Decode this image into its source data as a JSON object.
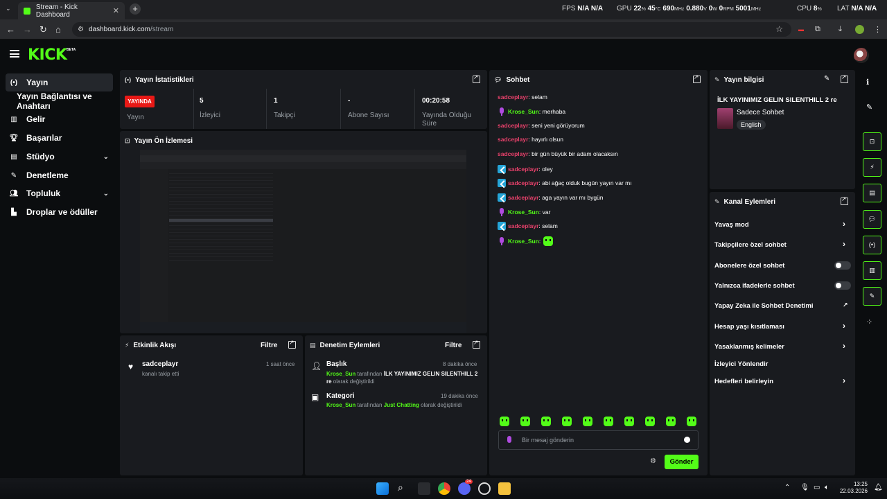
{
  "browser": {
    "tab_title": "Stream - Kick Dashboard",
    "url_domain": "dashboard.kick.com",
    "url_path": "/stream"
  },
  "overlay": {
    "fps_label": "FPS",
    "fps_value": "N/A",
    "fps_value2": "N/A",
    "gpu_label": "GPU",
    "gpu_load": "22",
    "gpu_temp": "45",
    "gpu_clock": "690",
    "gpu_volt": "0.880",
    "gpu_power": "0",
    "gpu_fan": "0",
    "gpu_mem": "5001",
    "cpu_label": "CPU",
    "cpu_load": "8",
    "lat_label": "LAT",
    "lat_value": "N/A",
    "lat_value2": "N/A"
  },
  "sidebar": {
    "items": [
      {
        "label": "Yayın",
        "icon": "broadcast-icon"
      },
      {
        "label": "Yayın Bağlantısı ve Anahtarı"
      },
      {
        "label": "Gelir",
        "icon": "revenue-icon"
      },
      {
        "label": "Başarılar",
        "icon": "trophy-icon"
      },
      {
        "label": "Stüdyo",
        "icon": "studio-icon"
      },
      {
        "label": "Denetleme",
        "icon": "wrench-icon"
      },
      {
        "label": "Topluluk",
        "icon": "community-icon"
      },
      {
        "label": "Droplar ve ödüller",
        "icon": "drops-icon"
      }
    ]
  },
  "stats": {
    "title": "Yayın İstatistikleri",
    "live_badge": "YAYINDA",
    "items": [
      {
        "value": "",
        "label": "Yayın"
      },
      {
        "value": "5",
        "label": "İzleyici"
      },
      {
        "value": "1",
        "label": "Takipçi"
      },
      {
        "value": "-",
        "label": "Abone Sayısı"
      },
      {
        "value": "00:20:58",
        "label": "Yayında Olduğu Süre"
      }
    ]
  },
  "preview": {
    "title": "Yayın Ön İzlemesi"
  },
  "activity": {
    "title": "Etkinlik Akışı",
    "filter": "Filtre",
    "events": [
      {
        "user": "sadceplayr",
        "text": "kanalı takip etti",
        "time": "1 saat önce"
      }
    ]
  },
  "mod_actions": {
    "title": "Denetim Eylemleri",
    "filter": "Filtre",
    "items": [
      {
        "heading": "Başlık",
        "time": "8 dakika önce",
        "user": "Krose_Sun",
        "by": "tarafından",
        "value": "İLK YAYINIMIZ GELIN SILENTHILL 2 re",
        "suffix": "olarak değiştirildi"
      },
      {
        "heading": "Kategori",
        "time": "19 dakika önce",
        "user": "Krose_Sun",
        "by": "tarafından",
        "value": "Just Chatting",
        "suffix": "olarak değiştirildi"
      }
    ]
  },
  "chat": {
    "title": "Sohbet",
    "messages": [
      {
        "user": "sadceplayr",
        "text": ": selam",
        "badge": "none",
        "color": "red"
      },
      {
        "user": "Krose_Sun",
        "text": ": merhaba",
        "badge": "mic",
        "color": "green"
      },
      {
        "user": "sadceplayr",
        "text": ": seni yeni görüyorum",
        "badge": "none",
        "color": "red"
      },
      {
        "user": "sadceplayr",
        "text": ": hayırlı olsun",
        "badge": "none",
        "color": "red"
      },
      {
        "user": "sadceplayr",
        "text": ": bir gün büyük bir adam olacaksın",
        "badge": "none",
        "color": "red"
      },
      {
        "user": "sadceplayr",
        "text": ": oley",
        "badge": "blue",
        "color": "red"
      },
      {
        "user": "sadceplayr",
        "text": ": abi ağaç olduk bugün yayın var mı",
        "badge": "blue",
        "color": "red"
      },
      {
        "user": "sadceplayr",
        "text": ": aga yayın var mı bygün",
        "badge": "blue",
        "color": "red"
      },
      {
        "user": "Krose_Sun",
        "text": ": var",
        "badge": "mic",
        "color": "green"
      },
      {
        "user": "sadceplayr",
        "text": ": selam",
        "badge": "blue",
        "color": "red"
      },
      {
        "user": "Krose_Sun",
        "text": ":",
        "badge": "mic",
        "color": "green",
        "emote": true
      }
    ],
    "input_placeholder": "Bir mesaj gönderin",
    "send_label": "Gönder"
  },
  "stream_info": {
    "title": "Yayın bilgisi",
    "stream_title": "İLK YAYINIMIZ GELIN SILENTHILL 2 re",
    "category": "Sadece Sohbet",
    "language": "English"
  },
  "channel_actions": {
    "title": "Kanal Eylemleri",
    "items": [
      {
        "label": "Yavaş mod",
        "control": "chevron"
      },
      {
        "label": "Takipçilere özel sohbet",
        "control": "chevron"
      },
      {
        "label": "Abonelere özel sohbet",
        "control": "toggle"
      },
      {
        "label": "Yalnızca ifadelerle sohbet",
        "control": "toggle"
      },
      {
        "label": "Yapay Zeka ile Sohbet Denetimi",
        "control": "external"
      },
      {
        "label": "Hesap yaşı kısıtlaması",
        "control": "chevron"
      },
      {
        "label": "Yasaklanmış kelimeler",
        "control": "chevron"
      },
      {
        "label": "İzleyici Yönlendir",
        "control": "none"
      },
      {
        "label": "Hedefleri belirleyin",
        "control": "chevron"
      }
    ]
  },
  "taskbar": {
    "time": "13:25",
    "date": "22.03.2026",
    "discord_badge": "24"
  },
  "colors": {
    "brand": "#53fc18",
    "live": "#e91916",
    "username_red": "#e8416b",
    "panel": "#191b1f"
  }
}
